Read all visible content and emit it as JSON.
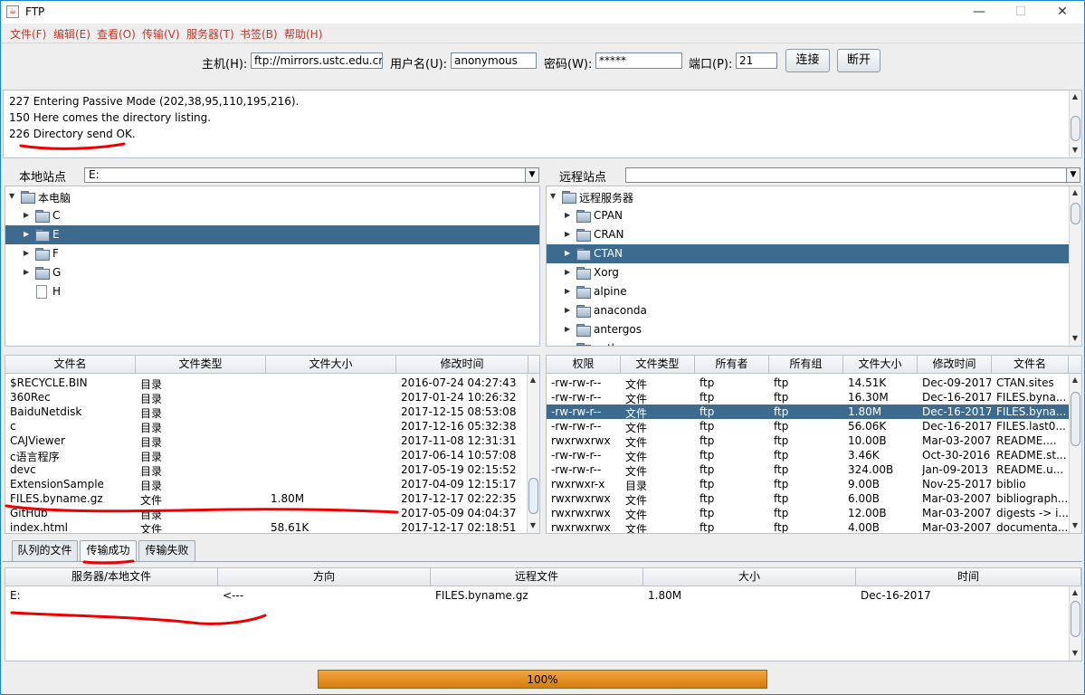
{
  "window": {
    "title": "FTP",
    "minimize": "—",
    "maximize": "☐",
    "close": "✕"
  },
  "menu": [
    "文件(F)",
    "编辑(E)",
    "查看(O)",
    "传输(V)",
    "服务器(T)",
    "书签(B)",
    "帮助(H)"
  ],
  "connect": {
    "host_label": "主机(H):",
    "host_value": "ftp://mirrors.ustc.edu.cn/",
    "user_label": "用户名(U):",
    "user_value": "anonymous",
    "pass_label": "密码(W):",
    "pass_value": "*****",
    "port_label": "端口(P):",
    "port_value": "21",
    "connect_btn": "连接",
    "disconnect_btn": "断开"
  },
  "log": [
    "227 Entering Passive Mode (202,38,95,110,195,216).",
    "150 Here comes the directory listing.",
    "226 Directory send OK."
  ],
  "local": {
    "label": "本地站点",
    "path": "E:",
    "root": "本电脑",
    "nodes": [
      {
        "name": "C",
        "type": "folder",
        "selected": false
      },
      {
        "name": "E",
        "type": "folder",
        "selected": true
      },
      {
        "name": "F",
        "type": "folder",
        "selected": false
      },
      {
        "name": "G",
        "type": "folder",
        "selected": false
      },
      {
        "name": "H",
        "type": "file",
        "selected": false
      }
    ],
    "columns": [
      "文件名",
      "文件类型",
      "文件大小",
      "修改时间"
    ],
    "rows": [
      [
        "$RECYCLE.BIN",
        "目录",
        "",
        "2016-07-24   04:27:43"
      ],
      [
        "360Rec",
        "目录",
        "",
        "2017-01-24   10:26:32"
      ],
      [
        "BaiduNetdisk",
        "目录",
        "",
        "2017-12-15   08:53:08"
      ],
      [
        "c",
        "目录",
        "",
        "2017-12-16   05:32:38"
      ],
      [
        "CAJViewer",
        "目录",
        "",
        "2017-11-08   12:31:31"
      ],
      [
        "c语言程序",
        "目录",
        "",
        "2017-06-14   10:57:08"
      ],
      [
        "devc",
        "目录",
        "",
        "2017-05-19   02:15:52"
      ],
      [
        "ExtensionSample",
        "目录",
        "",
        "2017-04-09   12:15:17"
      ],
      [
        "FILES.byname.gz",
        "文件",
        "1.80M",
        "2017-12-17   02:22:35"
      ],
      [
        "GitHub",
        "目录",
        "",
        "2017-05-09   04:04:37"
      ],
      [
        "index.html",
        "文件",
        "58.61K",
        "2017-12-17   02:18:51"
      ]
    ]
  },
  "remote": {
    "label": "远程站点",
    "path": "",
    "root": "远程服务器",
    "nodes": [
      {
        "name": "CPAN",
        "selected": false
      },
      {
        "name": "CRAN",
        "selected": false
      },
      {
        "name": "CTAN",
        "selected": true
      },
      {
        "name": "Xorg",
        "selected": false
      },
      {
        "name": "alpine",
        "selected": false
      },
      {
        "name": "anaconda",
        "selected": false
      },
      {
        "name": "antergos",
        "selected": false
      },
      {
        "name": "anthon",
        "selected": false
      }
    ],
    "columns": [
      "权限",
      "文件类型",
      "所有者",
      "所有组",
      "文件大小",
      "修改时间",
      "文件名"
    ],
    "rows": [
      [
        "-rw-rw-r--",
        "文件",
        "ftp",
        "ftp",
        "14.51K",
        "Dec-09-2017",
        "CTAN.sites"
      ],
      [
        "-rw-rw-r--",
        "文件",
        "ftp",
        "ftp",
        "16.30M",
        "Dec-16-2017",
        "FILES.byna..."
      ],
      [
        "-rw-rw-r--",
        "文件",
        "ftp",
        "ftp",
        "1.80M",
        "Dec-16-2017",
        "FILES.byna..."
      ],
      [
        "-rw-rw-r--",
        "文件",
        "ftp",
        "ftp",
        "56.06K",
        "Dec-16-2017",
        "FILES.last0..."
      ],
      [
        "rwxrwxrwx",
        "文件",
        "ftp",
        "ftp",
        "10.00B",
        "Mar-03-2007",
        "README...."
      ],
      [
        "-rw-rw-r--",
        "文件",
        "ftp",
        "ftp",
        "3.46K",
        "Oct-30-2016",
        "README.st..."
      ],
      [
        "-rw-rw-r--",
        "文件",
        "ftp",
        "ftp",
        "324.00B",
        "Jan-09-2013",
        "README.u..."
      ],
      [
        "rwxrwxr-x",
        "目录",
        "ftp",
        "ftp",
        "9.00B",
        "Nov-25-2017",
        "biblio"
      ],
      [
        "rwxrwxrwx",
        "文件",
        "ftp",
        "ftp",
        "6.00B",
        "Mar-03-2007",
        "bibliograph..."
      ],
      [
        "rwxrwxrwx",
        "文件",
        "ftp",
        "ftp",
        "12.00B",
        "Mar-03-2007",
        "digests -> i..."
      ],
      [
        "rwxrwxrwx",
        "文件",
        "ftp",
        "ftp",
        "4.00B",
        "Mar-03-2007",
        "documenta..."
      ]
    ]
  },
  "tabs": [
    {
      "label": "队列的文件",
      "active": false
    },
    {
      "label": "传输成功",
      "active": true
    },
    {
      "label": "传输失败",
      "active": false
    }
  ],
  "transfer": {
    "columns": [
      "服务器/本地文件",
      "方向",
      "远程文件",
      "大小",
      "时间"
    ],
    "rows": [
      [
        "E:",
        "<---",
        "FILES.byname.gz",
        "1.80M",
        "Dec-16-2017"
      ]
    ]
  },
  "progress": {
    "text": "100%",
    "value": 1.0
  },
  "colors": {
    "selection": "#3d6b8f",
    "menu_text": "#c0392b",
    "progress": "#e08a12",
    "annotation": "#ee0000"
  }
}
